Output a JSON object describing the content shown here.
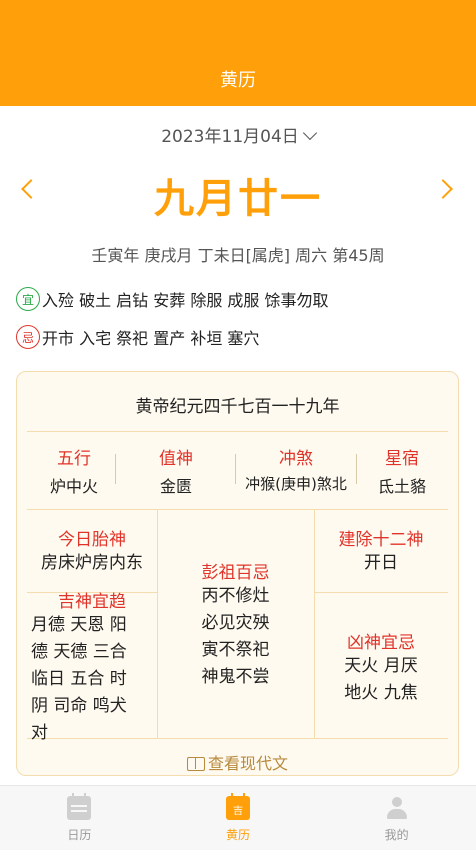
{
  "header": {
    "title": "黄历"
  },
  "date": {
    "solar": "2023年11月04日"
  },
  "lunar": {
    "date": "九月廿一"
  },
  "ganzhi": "壬寅年 庚戌月 丁未日[属虎] 周六 第45周",
  "yi": {
    "badge": "宜",
    "text": "入殓 破土 启钻 安葬 除服 成服 馀事勿取"
  },
  "ji": {
    "badge": "忌",
    "text": "开市 入宅 祭祀 置产 补垣 塞穴"
  },
  "card": {
    "title": "黄帝纪元四千七百一十九年",
    "wuxing": {
      "label": "五行",
      "value": "炉中火"
    },
    "zhishen": {
      "label": "值神",
      "value": "金匮"
    },
    "chongsha": {
      "label": "冲煞",
      "value": "冲猴(庚申)煞北"
    },
    "xingxiu": {
      "label": "星宿",
      "value": "氐土貉"
    },
    "taishen": {
      "label": "今日胎神",
      "value": "房床炉房内东"
    },
    "jishen": {
      "label": "吉神宜趋",
      "lines": [
        "月德 天恩 阳",
        "德 天德 三合",
        "临日 五合 时",
        "阴 司命 鸣犬",
        "对"
      ]
    },
    "pengzu": {
      "label": "彭祖百忌",
      "lines": [
        "丙不修灶",
        "必见灾殃",
        "寅不祭祀",
        "神鬼不尝"
      ]
    },
    "jianchu": {
      "label": "建除十二神",
      "value": "开日"
    },
    "xiongshen": {
      "label": "凶神宜忌",
      "lines": [
        "天火 月厌",
        "地火 九焦"
      ]
    },
    "readmore": "查看现代文"
  },
  "tabs": [
    {
      "label": "日历",
      "icon": "calendar-icon"
    },
    {
      "label": "黄历",
      "icon": "huangli-icon",
      "icon_text": "吉"
    },
    {
      "label": "我的",
      "icon": "user-icon"
    }
  ],
  "colors": {
    "accent": "#ff9f0a",
    "red": "#e0342b",
    "green": "#2aa84a"
  }
}
